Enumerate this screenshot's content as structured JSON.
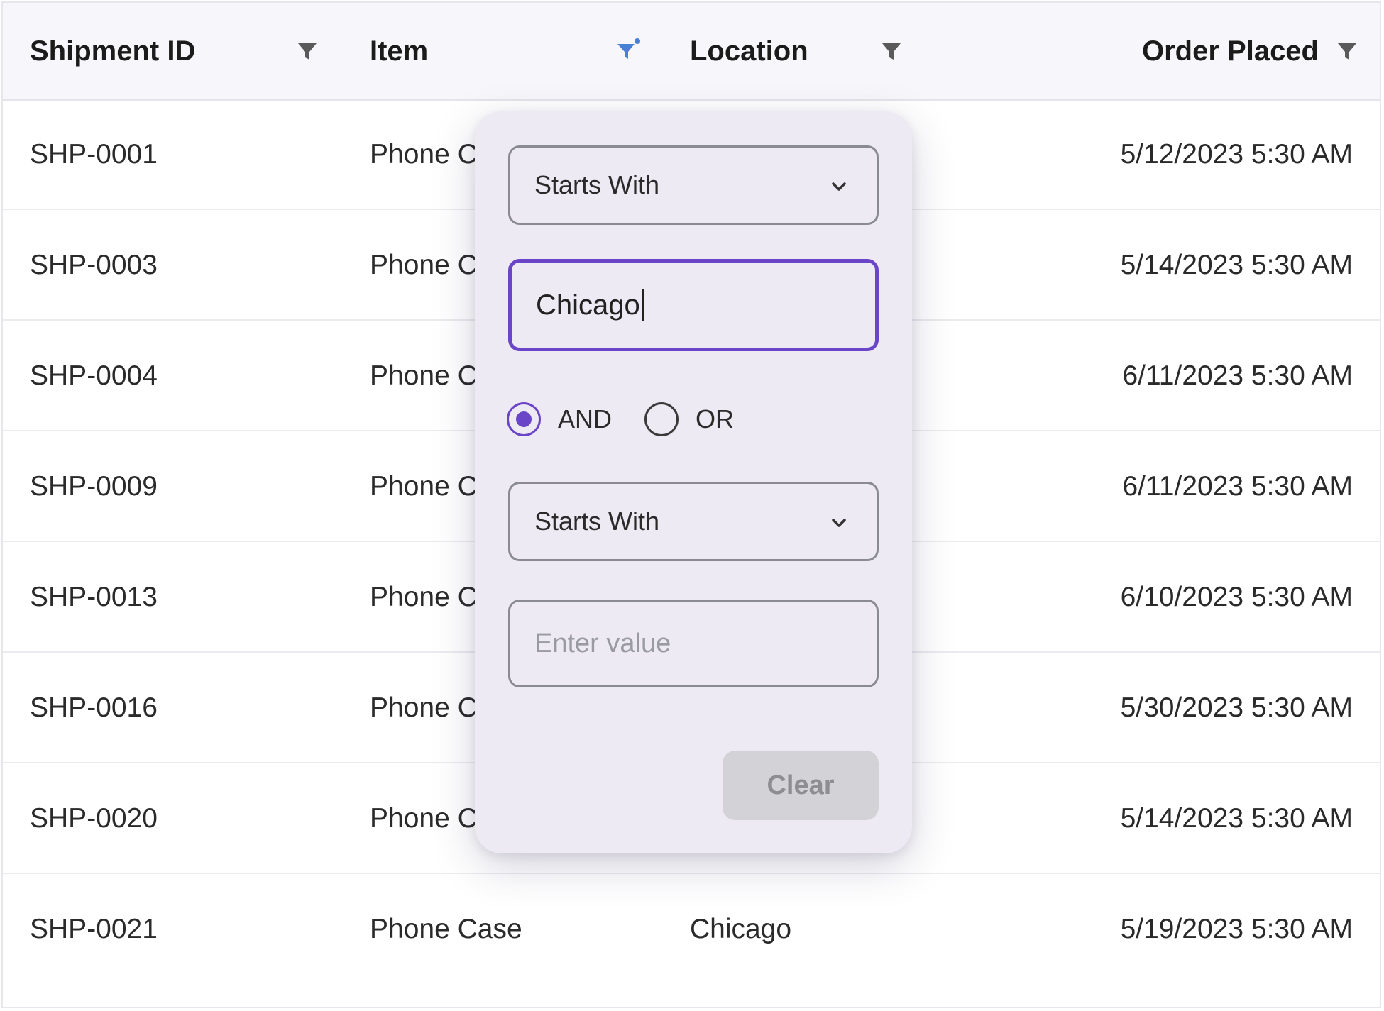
{
  "colors": {
    "accent": "#6a45c8",
    "active_filter_icon": "#4a7fd6",
    "inactive_filter_icon": "#5a5a5a",
    "popup_bg": "#edeaf3",
    "header_bg": "#f7f7fb"
  },
  "table": {
    "columns": [
      {
        "label": "Shipment ID",
        "filter_icon": "filter-icon",
        "filter_active": false
      },
      {
        "label": "Item",
        "filter_icon": "filter-active-icon",
        "filter_active": true
      },
      {
        "label": "Location",
        "filter_icon": "filter-icon",
        "filter_active": false
      },
      {
        "label": "Order Placed",
        "filter_icon": "filter-icon",
        "filter_active": false
      }
    ],
    "rows": [
      {
        "id": "SHP-0001",
        "item": "Phone C",
        "location": "",
        "date": "5/12/2023 5:30 AM"
      },
      {
        "id": "SHP-0003",
        "item": "Phone C",
        "location": "",
        "date": "5/14/2023 5:30 AM"
      },
      {
        "id": "SHP-0004",
        "item": "Phone C",
        "location": "",
        "date": "6/11/2023 5:30 AM"
      },
      {
        "id": "SHP-0009",
        "item": "Phone C",
        "location": "",
        "date": "6/11/2023 5:30 AM"
      },
      {
        "id": "SHP-0013",
        "item": "Phone C",
        "location": "",
        "date": "6/10/2023 5:30 AM"
      },
      {
        "id": "SHP-0016",
        "item": "Phone C",
        "location": "",
        "date": "5/30/2023 5:30 AM"
      },
      {
        "id": "SHP-0020",
        "item": "Phone C",
        "location": "",
        "date": "5/14/2023 5:30 AM"
      },
      {
        "id": "SHP-0021",
        "item": "Phone Case",
        "location": "Chicago",
        "date": "5/19/2023 5:30 AM"
      }
    ]
  },
  "filter_popup": {
    "condition1": {
      "operator": "Starts With",
      "value": "Chicago",
      "icon": "chevron-down-icon"
    },
    "logic": {
      "options": [
        {
          "label": "AND",
          "checked": true
        },
        {
          "label": "OR",
          "checked": false
        }
      ]
    },
    "condition2": {
      "operator": "Starts With",
      "value": "",
      "placeholder": "Enter value",
      "icon": "chevron-down-icon"
    },
    "clear_label": "Clear"
  }
}
